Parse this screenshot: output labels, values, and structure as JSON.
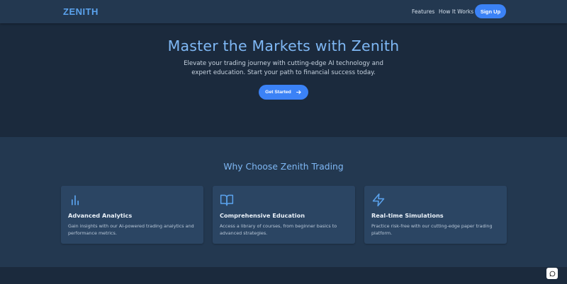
{
  "nav": {
    "logo": "ZENITH",
    "links": [
      "Features",
      "How It Works"
    ],
    "signup_label": "Sign Up"
  },
  "hero": {
    "title": "Master the Markets with Zenith",
    "subtitle": "Elevate your trading journey with cutting-edge AI technology and expert education. Start your path to financial success today.",
    "cta_label": "Get Started",
    "cta_icon": "arrow-right-icon"
  },
  "features": {
    "title": "Why Choose Zenith Trading",
    "cards": [
      {
        "icon": "bar-chart-icon",
        "title": "Advanced Analytics",
        "description": "Gain insights with our AI-powered trading analytics and performance metrics."
      },
      {
        "icon": "book-open-icon",
        "title": "Comprehensive Education",
        "description": "Access a library of courses, from beginner basics to advanced strategies."
      },
      {
        "icon": "lightning-icon",
        "title": "Real-time Simulations",
        "description": "Practice risk-free with our cutting-edge paper trading platform."
      }
    ]
  },
  "chat": {
    "icon": "chat-bubble-icon"
  },
  "colors": {
    "accent": "#3b82f6",
    "heading": "#7fb8f5",
    "logo": "#5ba3ee",
    "background": "#1b2a3d",
    "panel": "#233850",
    "card": "#2b4563"
  }
}
